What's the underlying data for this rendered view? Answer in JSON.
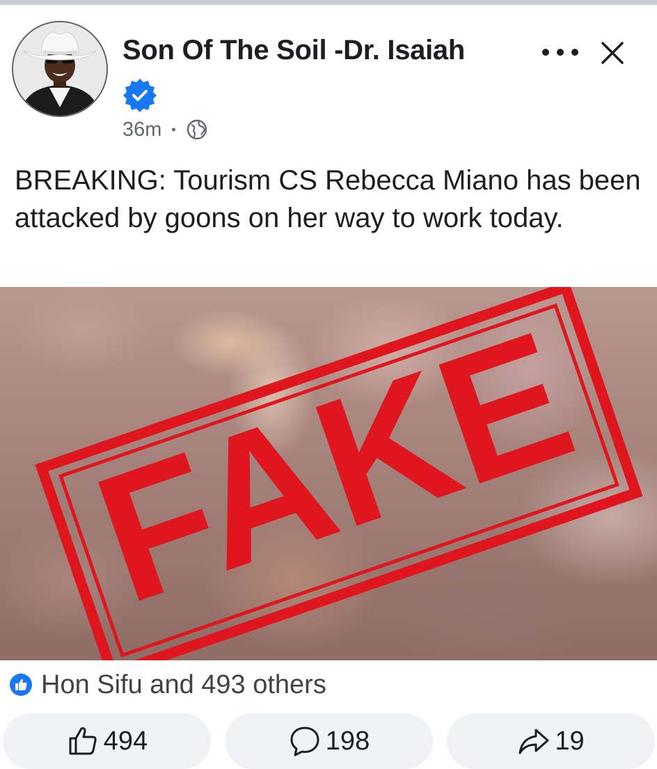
{
  "post": {
    "author": "Son Of The Soil -Dr. Isaiah",
    "time": "36m",
    "separator": "•",
    "audience_icon": "globe-icon",
    "text": "BREAKING: Tourism CS Rebecca Miano has been attacked by goons on her way to work today.",
    "image": {
      "stamp_text": "FAKE",
      "stamp_color": "#e0161e"
    }
  },
  "reactions": {
    "summary": "Hon Sifu and 493 others",
    "icon": "like-badge-icon"
  },
  "actions": {
    "like_count": "494",
    "comment_count": "198",
    "share_count": "19"
  },
  "colors": {
    "verified": "#1877f2",
    "button_bg": "#f0f2f5",
    "text": "#1c1e21",
    "muted": "#606770"
  }
}
